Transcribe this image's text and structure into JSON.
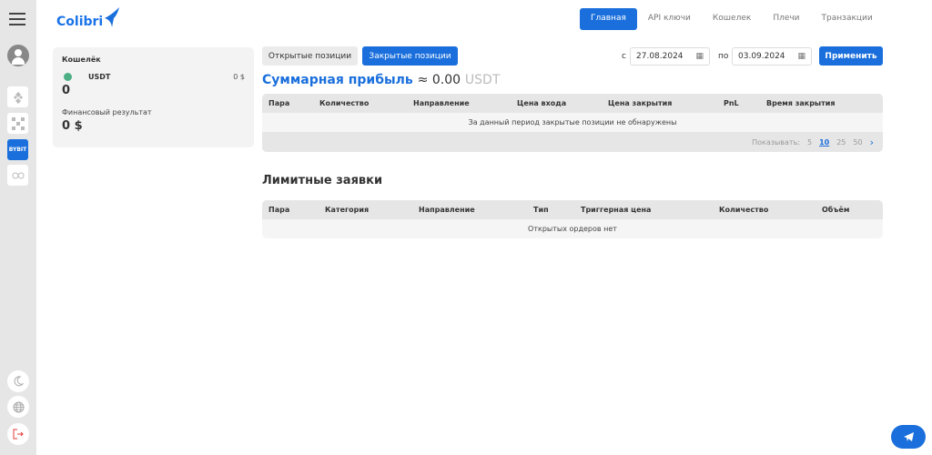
{
  "app": {
    "logo": "Colibri"
  },
  "nav": [
    "Главная",
    "API ключи",
    "Кошелек",
    "Плечи",
    "Транзакции"
  ],
  "sidebar": {
    "exchanges": [
      "binance",
      "okx",
      "BYBIT",
      "other"
    ]
  },
  "wallet": {
    "title": "Кошелёк",
    "currency": "USDT",
    "usd": "0 $",
    "amount": "0",
    "fin_label": "Финансовый результат",
    "fin_value": "0 $"
  },
  "tabs": {
    "open": "Открытые позиции",
    "closed": "Закрытые позиции"
  },
  "filter": {
    "from_label": "с",
    "from": "27.08.2024",
    "to_label": "по",
    "to": "03.09.2024",
    "apply": "Применить"
  },
  "summary": {
    "label": "Суммарная прибыль",
    "approx": "≈ 0.00",
    "unit": "USDT"
  },
  "closed_table": {
    "headers": [
      "Пара",
      "Количество",
      "Направление",
      "Цена входа",
      "Цена закрытия",
      "PnL",
      "Время закрытия"
    ],
    "empty": "За данный период закрытые позиции не обнаружены",
    "show_label": "Показывать:",
    "page_sizes": [
      "5",
      "10",
      "25",
      "50"
    ],
    "next": "›"
  },
  "limit": {
    "title": "Лимитные заявки",
    "headers": [
      "Пара",
      "Категория",
      "Направление",
      "Тип",
      "Триггерная цена",
      "Количество",
      "Объём"
    ],
    "empty": "Открытых ордеров нет"
  },
  "colors": {
    "accent": "#1a6fdc",
    "green": "#4caf85"
  }
}
